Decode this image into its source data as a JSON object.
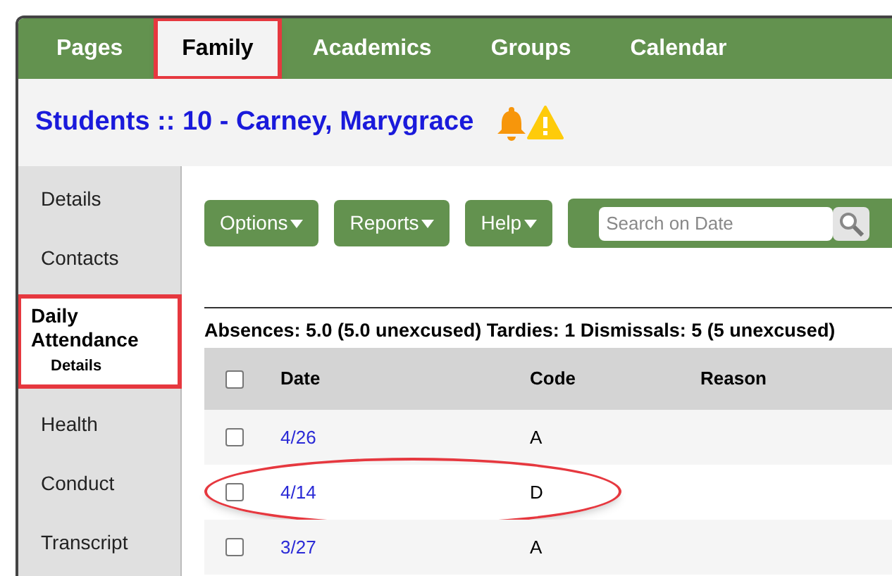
{
  "nav": {
    "tabs": [
      {
        "label": "Pages",
        "selected": false,
        "highlighted": false
      },
      {
        "label": "Family",
        "selected": true,
        "highlighted": true
      },
      {
        "label": "Academics",
        "selected": false,
        "highlighted": false
      },
      {
        "label": "Groups",
        "selected": false,
        "highlighted": false
      },
      {
        "label": "Calendar",
        "selected": false,
        "highlighted": false
      }
    ]
  },
  "header": {
    "title_prefix": "Students",
    "separator": "::",
    "title": "10 - Carney, Marygrace"
  },
  "sidebar": {
    "items": [
      {
        "label": "Details",
        "selected": false,
        "highlighted": false
      },
      {
        "label": "Contacts",
        "selected": false,
        "highlighted": false
      },
      {
        "label": "Daily Attendance",
        "selected": true,
        "highlighted": true,
        "children": [
          {
            "label": "Details"
          }
        ]
      },
      {
        "label": "Health",
        "selected": false,
        "highlighted": false
      },
      {
        "label": "Conduct",
        "selected": false,
        "highlighted": false
      },
      {
        "label": "Transcript",
        "selected": false,
        "highlighted": false
      }
    ]
  },
  "toolbar": {
    "buttons": [
      "Options",
      "Reports",
      "Help"
    ],
    "search": {
      "placeholder": "Search on Date"
    }
  },
  "summary": "Absences: 5.0 (5.0 unexcused) Tardies: 1 Dismissals: 5 (5 unexcused)",
  "table": {
    "select_all_checked": false,
    "columns": [
      "Date",
      "Code",
      "Reason"
    ],
    "rows": [
      {
        "date": "4/26",
        "code": "A",
        "checked": false,
        "highlighted": false
      },
      {
        "date": "4/14",
        "code": "D",
        "checked": false,
        "highlighted": true
      },
      {
        "date": "3/27",
        "code": "A",
        "checked": false,
        "highlighted": false
      }
    ]
  }
}
